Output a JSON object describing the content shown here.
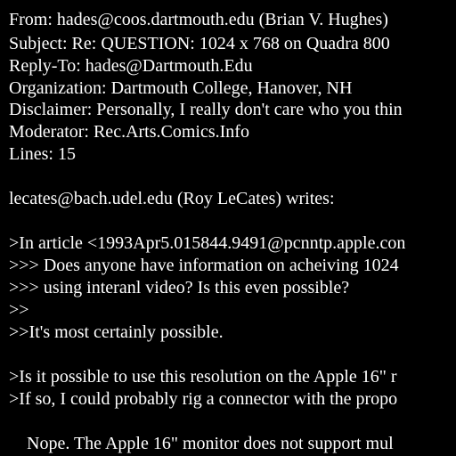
{
  "message": {
    "headers": [
      "From: hades@coos.dartmouth.edu (Brian V. Hughes)",
      "Subject: Re: QUESTION: 1024 x 768 on Quadra 800",
      "Reply-To: hades@Dartmouth.Edu",
      "Organization: Dartmouth College, Hanover, NH",
      "Disclaimer: Personally, I really don't care who you thin",
      "Moderator: Rec.Arts.Comics.Info",
      "Lines: 15"
    ],
    "attribution": "lecates@bach.udel.edu (Roy LeCates) writes:",
    "quote_block_1": [
      ">In article <1993Apr5.015844.9491@pcnntp.apple.con",
      ">>> Does anyone have information on acheiving 1024",
      ">>> using interanl video? Is this even possible?",
      ">>",
      ">>It's most certainly possible."
    ],
    "quote_block_2": [
      ">Is it possible to use this resolution on the Apple 16\" r",
      ">If so, I could probably rig a connector with the propo"
    ],
    "body": [
      "    Nope. The Apple 16\" monitor does not support mul"
    ]
  },
  "colors": {
    "background": "#000000",
    "text": "#ffffff"
  }
}
